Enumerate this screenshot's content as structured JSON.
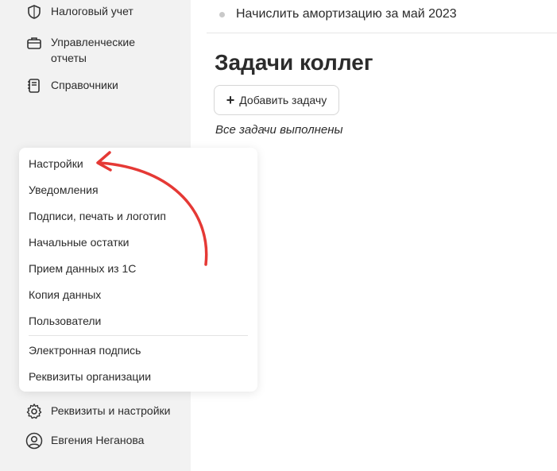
{
  "sidebar": {
    "items": [
      {
        "label": "Налоговый учет",
        "icon": "shield-icon"
      },
      {
        "label": "Управленческие отчеты",
        "icon": "briefcase-icon"
      },
      {
        "label": "Справочники",
        "icon": "notebook-icon"
      },
      {
        "label": "Реквизиты и настройки",
        "icon": "gear-icon"
      },
      {
        "label": "Евгения Неганова",
        "icon": "user-avatar-icon"
      }
    ]
  },
  "main": {
    "task_text": "Начислить амортизацию за май 2023",
    "section_title": "Задачи коллег",
    "add_task_label": "Добавить задачу",
    "add_task_icon": "plus-icon",
    "empty_note": "Все задачи выполнены"
  },
  "settings_menu": {
    "items": [
      "Настройки",
      "Уведомления",
      "Подписи, печать и логотип",
      "Начальные остатки",
      "Прием данных из 1С",
      "Копия данных",
      "Пользователи",
      "Электронная подпись",
      "Реквизиты организации"
    ]
  },
  "annotation": {
    "color": "#e53935",
    "icon": "curved-arrow-icon"
  }
}
